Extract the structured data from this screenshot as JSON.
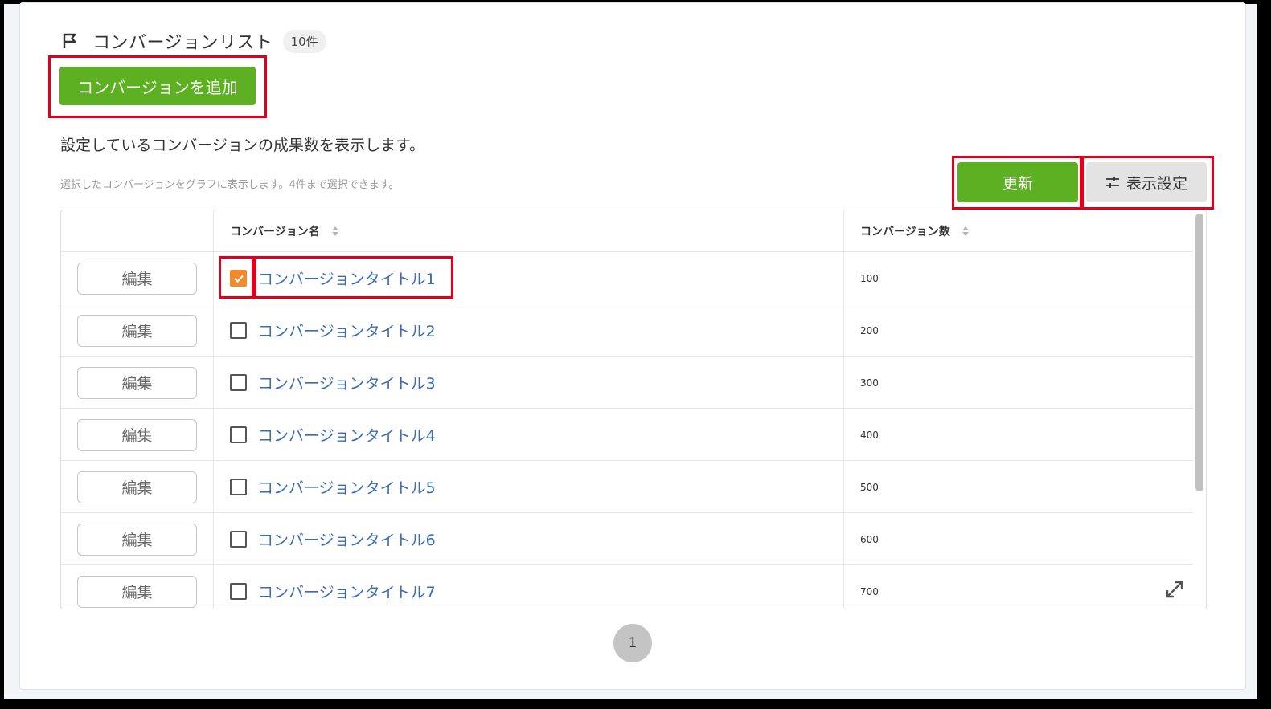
{
  "header": {
    "title": "コンバージョンリスト",
    "count_badge": "10件",
    "flag_icon": "flag-icon"
  },
  "actions": {
    "add_label": "コンバージョンを追加",
    "update_label": "更新",
    "settings_label": "表示設定",
    "settings_icon": "sliders-icon"
  },
  "text": {
    "description": "設定しているコンバージョンの成果数を表示します。",
    "hint": "選択したコンバージョンをグラフに表示します。4件まで選択できます。"
  },
  "table": {
    "columns": [
      "",
      "コンバージョン名",
      "コンバージョン数"
    ],
    "rows": [
      {
        "edit": "編集",
        "name": "コンバージョンタイトル1",
        "count": "100",
        "checked": true
      },
      {
        "edit": "編集",
        "name": "コンバージョンタイトル2",
        "count": "200",
        "checked": false
      },
      {
        "edit": "編集",
        "name": "コンバージョンタイトル3",
        "count": "300",
        "checked": false
      },
      {
        "edit": "編集",
        "name": "コンバージョンタイトル4",
        "count": "400",
        "checked": false
      },
      {
        "edit": "編集",
        "name": "コンバージョンタイトル5",
        "count": "500",
        "checked": false
      },
      {
        "edit": "編集",
        "name": "コンバージョンタイトル6",
        "count": "600",
        "checked": false
      },
      {
        "edit": "編集",
        "name": "コンバージョンタイトル7",
        "count": "700",
        "checked": false
      }
    ]
  },
  "pagination": {
    "current": "1"
  },
  "colors": {
    "accent_green": "#5cb022",
    "checkbox_orange": "#f28a2c",
    "link_blue": "#3a6bb6",
    "highlight_red": "#e0001b"
  }
}
